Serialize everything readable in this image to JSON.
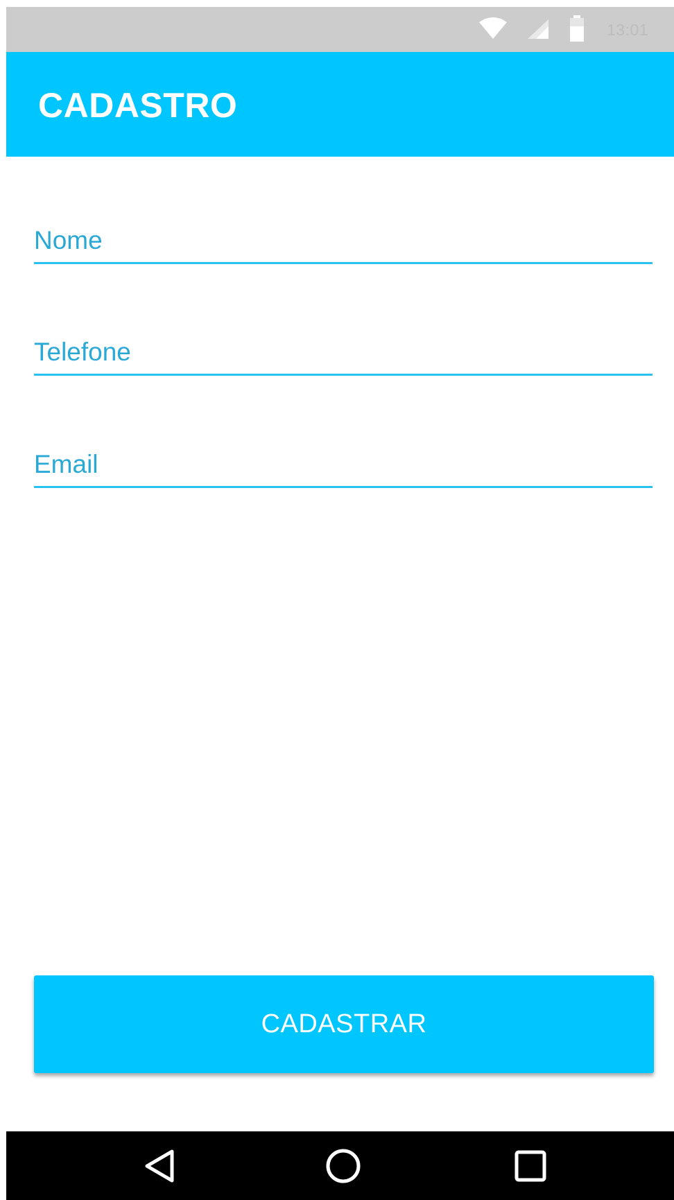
{
  "status_bar": {
    "time": "13:01",
    "icons": [
      "wifi-icon",
      "cell-signal-icon",
      "battery-icon"
    ]
  },
  "app_bar": {
    "title": "CADASTRO"
  },
  "form": {
    "fields": [
      {
        "name": "nome",
        "placeholder": "Nome",
        "value": ""
      },
      {
        "name": "telefone",
        "placeholder": "Telefone",
        "value": ""
      },
      {
        "name": "email",
        "placeholder": "Email",
        "value": ""
      }
    ],
    "submit_label": "CADASTRAR"
  },
  "nav_bar": {
    "buttons": [
      "back-icon",
      "home-icon",
      "recents-icon"
    ]
  },
  "colors": {
    "accent": "#00c6ff",
    "field_line": "#29c2f0",
    "placeholder_text": "#2aa8d6",
    "status_bar": "#cccccc",
    "nav_bar": "#000000"
  }
}
